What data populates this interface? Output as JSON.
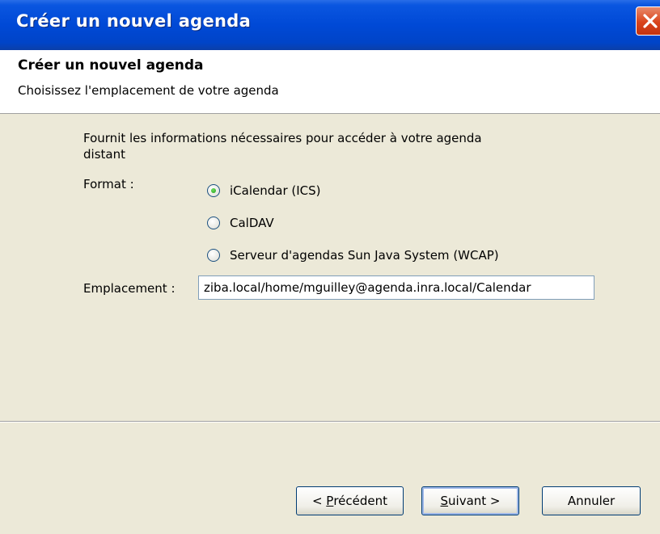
{
  "window": {
    "title": "Créer un nouvel agenda"
  },
  "header": {
    "title": "Créer un nouvel agenda",
    "subtitle": "Choisissez l'emplacement de votre agenda"
  },
  "form": {
    "info_line1": "Fournit les informations nécessaires pour accéder à votre agenda",
    "info_line2": "distant",
    "format_label": "Format :",
    "options": [
      {
        "label": "iCalendar (ICS)",
        "selected": true
      },
      {
        "label": "CalDAV",
        "selected": false
      },
      {
        "label": "Serveur d'agendas Sun Java System (WCAP)",
        "selected": false
      }
    ],
    "location_label": "Emplacement :",
    "location_value": "ziba.local/home/mguilley@agenda.inra.local/Calendar"
  },
  "buttons": {
    "back": {
      "prefix": "< ",
      "accel": "P",
      "rest": "récédent"
    },
    "next": {
      "accel": "S",
      "rest": "uivant >"
    },
    "cancel": "Annuler"
  },
  "colors": {
    "titlebar": "#0049d6",
    "dialog_bg": "#ece9d8",
    "close": "#d9441c"
  }
}
